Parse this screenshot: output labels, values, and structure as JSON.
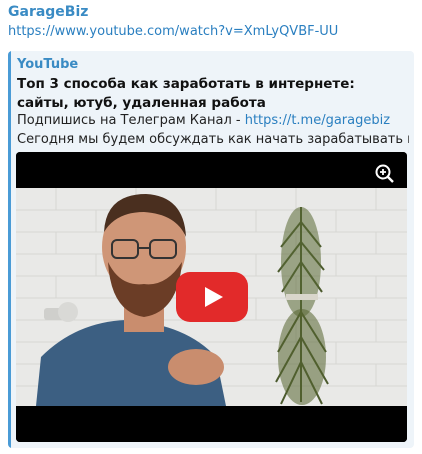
{
  "message": {
    "sender": "GarageBiz",
    "link": "https://www.youtube.com/watch?v=XmLyQVBF-UU"
  },
  "preview": {
    "site_name": "YouTube",
    "title": "Топ 3 способа как заработать в интернете: сайты, ютуб, удаленная работа",
    "subtitle_prefix": "Подпишись на Телеграм Канал - ",
    "subtitle_link": "https://t.me/garagebiz",
    "description": "Сегодня мы будем обсуждать как начать зарабатывать в инт...",
    "accent_color": "#4a9bd6"
  },
  "video": {
    "zoom_icon": "zoom-in-icon",
    "play_icon": "youtube-play-icon",
    "play_color": "#e22a2a"
  }
}
